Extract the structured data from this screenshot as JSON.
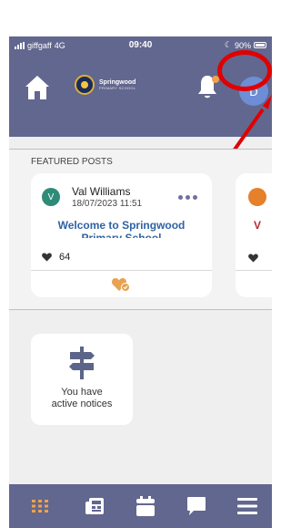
{
  "status": {
    "carrier": "giffgaff",
    "network": "4G",
    "time": "09:40",
    "battery": "90%"
  },
  "header": {
    "logo_name": "Springwood",
    "logo_sub": "PRIMARY SCHOOL",
    "avatar_initial": "D",
    "icons": [
      "home-icon",
      "bell-icon"
    ],
    "accent_color": "#62678f",
    "notification_dot_color": "#f0a24a"
  },
  "annotation": {
    "circle_color": "#e00000"
  },
  "featured": {
    "title": "FEATURED POSTS",
    "posts": [
      {
        "avatar_initial": "V",
        "author": "Val Williams",
        "date": "18/07/2023 11:51",
        "title": "Welcome to Springwood",
        "title_cont": "Primary School",
        "likes": "64"
      }
    ],
    "peek": {
      "title_letter": "V"
    }
  },
  "notices": {
    "text_line1": "You have",
    "text_line2": "active notices"
  },
  "tabbar": {
    "items": [
      "dashboard-icon",
      "news-icon",
      "calendar-icon",
      "messages-icon",
      "menu-icon"
    ],
    "active_color": "#f0a24a"
  }
}
